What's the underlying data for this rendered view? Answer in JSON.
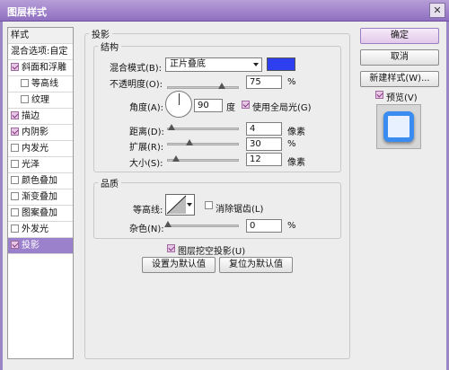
{
  "window": {
    "title": "图层样式",
    "close_glyph": "✕"
  },
  "sidebar": {
    "header": "样式",
    "blend_options": "混合选项:自定",
    "items": [
      {
        "label": "斜面和浮雕",
        "checked": true
      },
      {
        "label": "等高线",
        "checked": false
      },
      {
        "label": "纹理",
        "checked": false
      },
      {
        "label": "描边",
        "checked": true
      },
      {
        "label": "内阴影",
        "checked": true
      },
      {
        "label": "内发光",
        "checked": false
      },
      {
        "label": "光泽",
        "checked": false
      },
      {
        "label": "颜色叠加",
        "checked": false
      },
      {
        "label": "渐变叠加",
        "checked": false
      },
      {
        "label": "图案叠加",
        "checked": false
      },
      {
        "label": "外发光",
        "checked": false
      },
      {
        "label": "投影",
        "checked": true
      }
    ]
  },
  "panel": {
    "title": "投影",
    "structure": {
      "title": "结构",
      "blend_mode_label": "混合模式(B):",
      "blend_mode_value": "正片叠底",
      "blend_color": "#2e3ff0",
      "opacity_label": "不透明度(O):",
      "opacity_value": "75",
      "opacity_fraction": 0.75,
      "opacity_unit": "%",
      "angle_label": "角度(A):",
      "angle_value": "90",
      "angle_unit": "度",
      "global_light_label": "使用全局光(G)",
      "distance_label": "距离(D):",
      "distance_value": "4",
      "distance_unit": "像素",
      "spread_label": "扩展(R):",
      "spread_value": "30",
      "spread_unit": "%",
      "size_label": "大小(S):",
      "size_value": "12",
      "size_unit": "像素"
    },
    "quality": {
      "title": "品质",
      "contour_label": "等高线:",
      "antialias_label": "消除锯齿(L)",
      "noise_label": "杂色(N):",
      "noise_value": "0",
      "noise_unit": "%"
    },
    "knockout_label": "图层挖空投影(U)",
    "make_default": "设置为默认值",
    "reset_default": "复位为默认值"
  },
  "buttons": {
    "ok": "确定",
    "cancel": "取消",
    "new_style": "新建样式(W)...",
    "preview": "预览(V)"
  },
  "colors": {
    "accent": "#9b80cc",
    "preview_blue": "#3b8cf0"
  }
}
